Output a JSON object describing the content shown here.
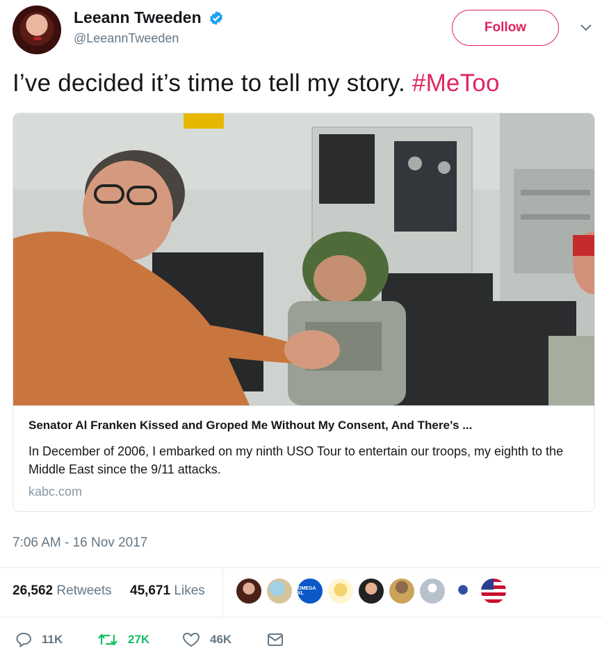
{
  "author": {
    "display_name": "Leeann Tweeden",
    "handle": "@LeeannTweeden",
    "verified": true,
    "avatar_icon": "user-avatar"
  },
  "follow_label": "Follow",
  "tweet": {
    "text": "I’ve decided it’s time to tell my story.",
    "hashtag": "#MeToo",
    "hashtag_color": "#e0245e"
  },
  "card": {
    "image_icon": "photo-thumbnail",
    "title": "Senator Al Franken Kissed and Groped Me Without My Consent, And There’s ...",
    "description": "In December of 2006, I embarked on my ninth USO Tour to entertain our troops, my eighth to the Middle East since the 9/11 attacks.",
    "domain": "kabc.com"
  },
  "timestamp": "7:06 AM - 16 Nov 2017",
  "stats": {
    "retweets_count": "26,562",
    "retweets_label": "Retweets",
    "likes_count": "45,671",
    "likes_label": "Likes"
  },
  "likers": [
    {
      "name": "liker-avatar-1"
    },
    {
      "name": "liker-avatar-2"
    },
    {
      "name": "liker-avatar-3",
      "text": "OMEGA XL"
    },
    {
      "name": "liker-avatar-4"
    },
    {
      "name": "liker-avatar-5"
    },
    {
      "name": "liker-avatar-6"
    },
    {
      "name": "liker-avatar-7"
    },
    {
      "name": "liker-avatar-8"
    },
    {
      "name": "liker-avatar-9"
    }
  ],
  "actions": {
    "reply_count": "11K",
    "retweet_count": "27K",
    "like_count": "46K"
  },
  "colors": {
    "accent": "#e0245e",
    "verified_blue": "#1da1f2",
    "retweet_green": "#17bf63",
    "secondary_text": "#657786"
  }
}
